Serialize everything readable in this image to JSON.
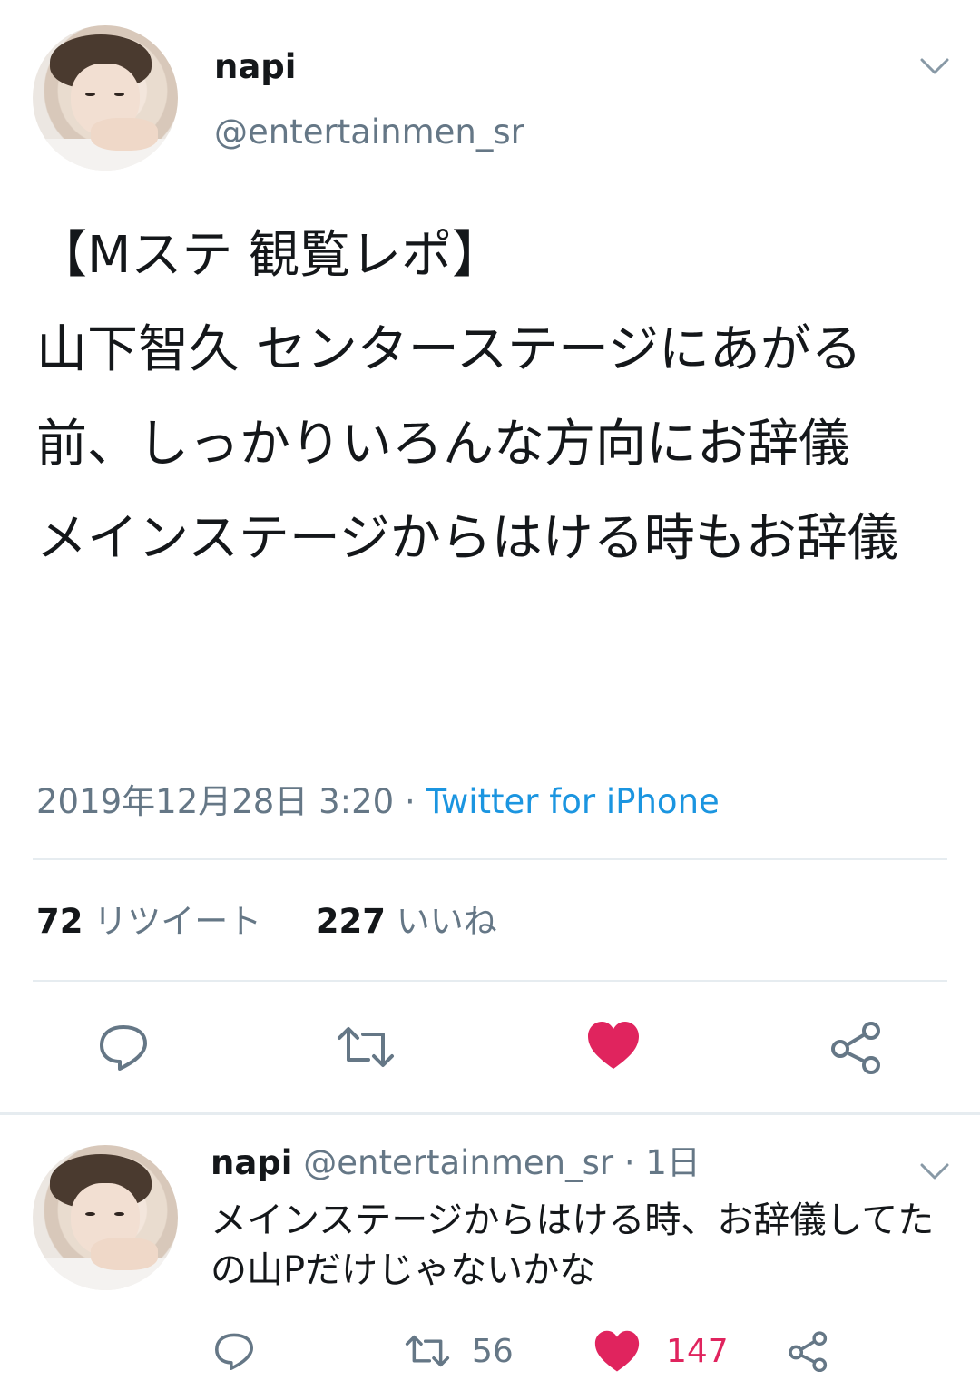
{
  "tweet": {
    "author_name": "napi",
    "author_handle": "@entertainmen_sr",
    "text": "【Mステ 観覧レポ】\n山下智久 センターステージにあがる前、しっかりいろんな方向にお辞儀\nメインステージからはける時もお辞儀",
    "timestamp": "2019年12月28日 3:20",
    "separator": " · ",
    "source": "Twitter for iPhone",
    "retweet_count": "72",
    "retweet_label": "リツイート",
    "like_count": "227",
    "like_label": "いいね",
    "liked": true
  },
  "reply": {
    "author_name": "napi",
    "author_handle": "@entertainmen_sr",
    "time": " · 1日",
    "text": "メインステージからはける時、お辞儀してたの山Pだけじゃないかな",
    "retweet_count": "56",
    "like_count": "147",
    "liked": true
  },
  "icons": {
    "menu": "chevron-down-icon",
    "reply": "reply-icon",
    "retweet": "retweet-icon",
    "like": "heart-icon",
    "share": "share-icon"
  },
  "colors": {
    "accent": "#1b95e0",
    "like": "#e0245e",
    "muted": "#657786",
    "text": "#14171a",
    "divider": "#e6ecf0"
  }
}
